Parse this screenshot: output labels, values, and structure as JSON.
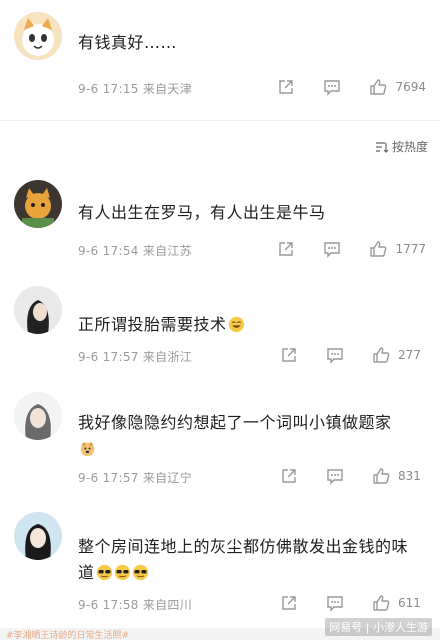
{
  "comments": [
    {
      "text": "有钱真好……",
      "date": "9-6 17:15",
      "location": "来自天津",
      "likes": "7694"
    },
    {
      "text": "有人出生在罗马，有人出生是牛马",
      "date": "9-6 17:54",
      "location": "来自江苏",
      "likes": "1777"
    },
    {
      "text": "正所谓投胎需要技术",
      "date": "9-6 17:57",
      "location": "来自浙江",
      "likes": "277"
    },
    {
      "text": "我好像隐隐约约想起了一个词叫小镇做题家",
      "date": "9-6 17:57",
      "location": "来自辽宁",
      "likes": "831"
    },
    {
      "text": "整个房间连地上的灰尘都仿佛散发出金钱的味道",
      "date": "9-6 17:58",
      "location": "来自四川",
      "likes": "611"
    }
  ],
  "sort_label": "按热度",
  "bottom_text": "#李湘晒王诗龄的日常生活照#",
  "watermark": "网易号 | 小渗人生游",
  "colors": {
    "meta": "#9a9a9a",
    "icon": "#999999"
  }
}
